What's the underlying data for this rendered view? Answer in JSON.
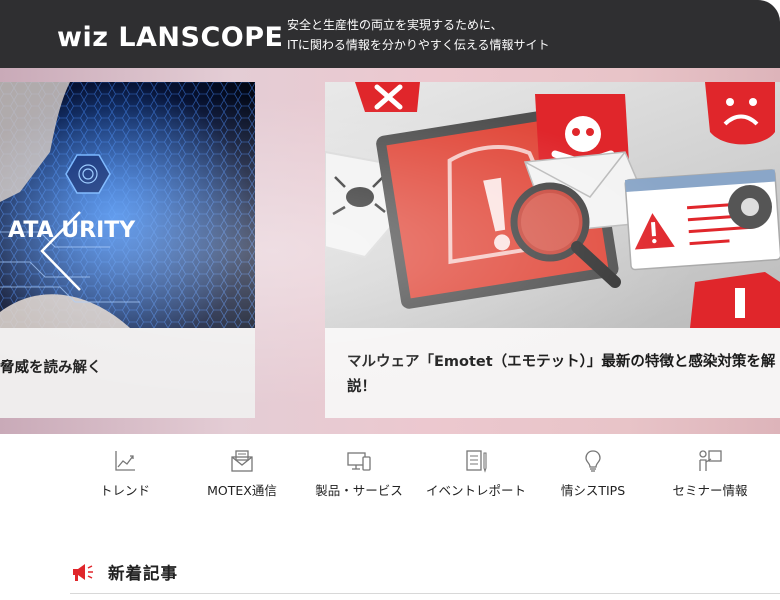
{
  "header": {
    "logo": "wiz LANSCOPE",
    "tagline_line1": "安全と生産性の両立を実現するために、",
    "tagline_line2": "ITに関わる情報を分かりやすく伝える情報サイト"
  },
  "carousel": {
    "slides": [
      {
        "caption": "脅威を読み解く",
        "image_text": "ATA URITY"
      },
      {
        "caption": "マルウェア「Emotet（エモテット）」最新の特徴と感染対策を解説！"
      }
    ]
  },
  "categories": [
    {
      "label": "トレンド",
      "icon": "trend-chart-icon"
    },
    {
      "label": "MOTEX通信",
      "icon": "envelope-icon"
    },
    {
      "label": "製品・サービス",
      "icon": "devices-icon"
    },
    {
      "label": "イベントレポート",
      "icon": "report-pen-icon"
    },
    {
      "label": "情シスTIPS",
      "icon": "lightbulb-icon"
    },
    {
      "label": "セミナー情報",
      "icon": "presenter-icon"
    }
  ],
  "section": {
    "title": "新着記事",
    "icon": "megaphone-icon"
  },
  "colors": {
    "header_bg": "#2f2f31",
    "accent_red": "#e0262b"
  }
}
